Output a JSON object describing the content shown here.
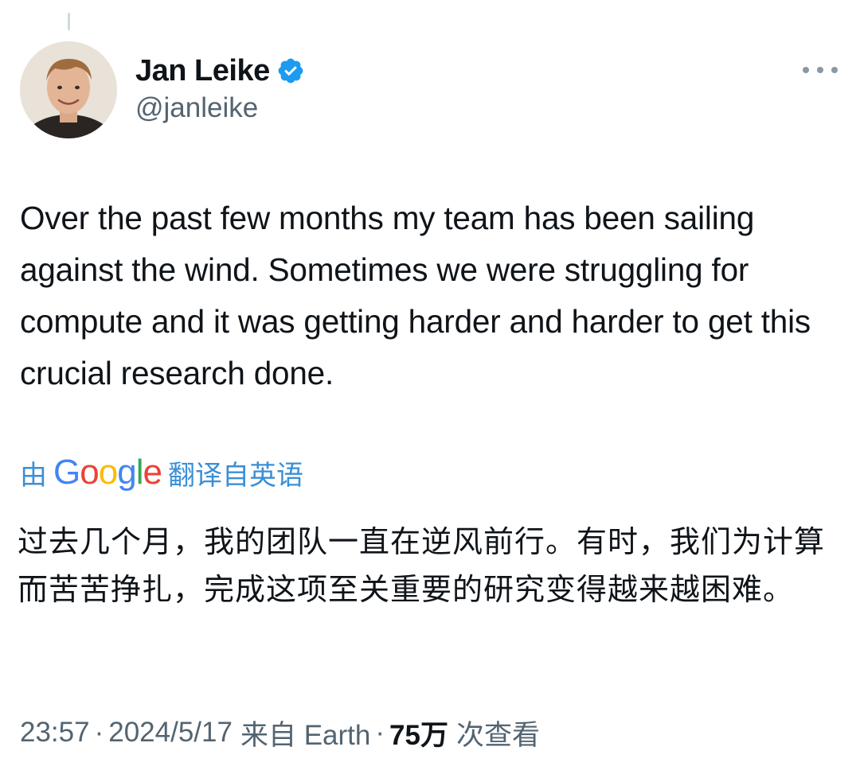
{
  "author": {
    "display_name": "Jan Leike",
    "handle": "@janleike",
    "verified": true
  },
  "icons": {
    "verified": "verified-badge-icon",
    "more": "more-horizontal-icon",
    "verified_color": "#1d9bf0"
  },
  "tweet": {
    "text": "Over the past few months my team has been sailing against the wind. Sometimes we were struggling for compute and it was getting harder and harder to get this crucial research done."
  },
  "translation": {
    "prefix": "由",
    "brand": "Google",
    "suffix": "翻译自英语",
    "text": "过去几个月，我的团队一直在逆风前行。有时，我们为计算而苦苦挣扎，完成这项至关重要的研究变得越来越困难。"
  },
  "meta": {
    "time": "23:57",
    "date": "2024/5/17",
    "source": "来自 Earth",
    "separator": "·",
    "views_count": "75万",
    "views_label": "次查看"
  }
}
